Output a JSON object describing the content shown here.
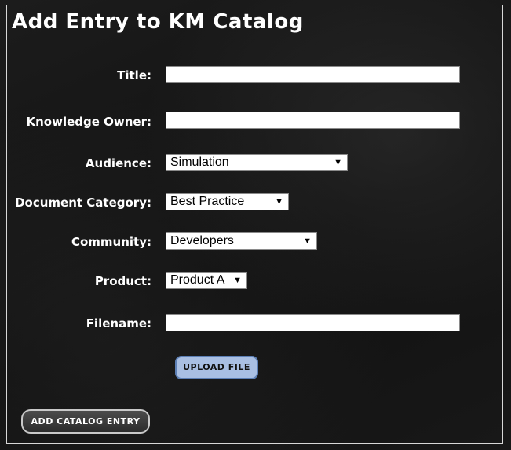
{
  "header": {
    "title": "Add Entry to KM Catalog"
  },
  "form": {
    "title_label": "Title:",
    "title_value": "",
    "owner_label": "Knowledge Owner:",
    "owner_value": "",
    "audience_label": "Audience:",
    "audience_value": "Simulation",
    "category_label": "Document Category:",
    "category_value": "Best Practice",
    "community_label": "Community:",
    "community_value": "Developers",
    "product_label": "Product:",
    "product_value": "Product A",
    "filename_label": "Filename:",
    "filename_value": ""
  },
  "buttons": {
    "upload_label": "UPLOAD FILE",
    "add_entry_label": "ADD CATALOG ENTRY"
  },
  "icons": {
    "dropdown_arrow": "▼"
  },
  "colors": {
    "background": "#151515",
    "border": "#d8d8d8",
    "upload_button_bg": "#a9bfe3",
    "upload_button_border": "#5c7fb5",
    "add_button_bg": "#3c3c3c"
  }
}
